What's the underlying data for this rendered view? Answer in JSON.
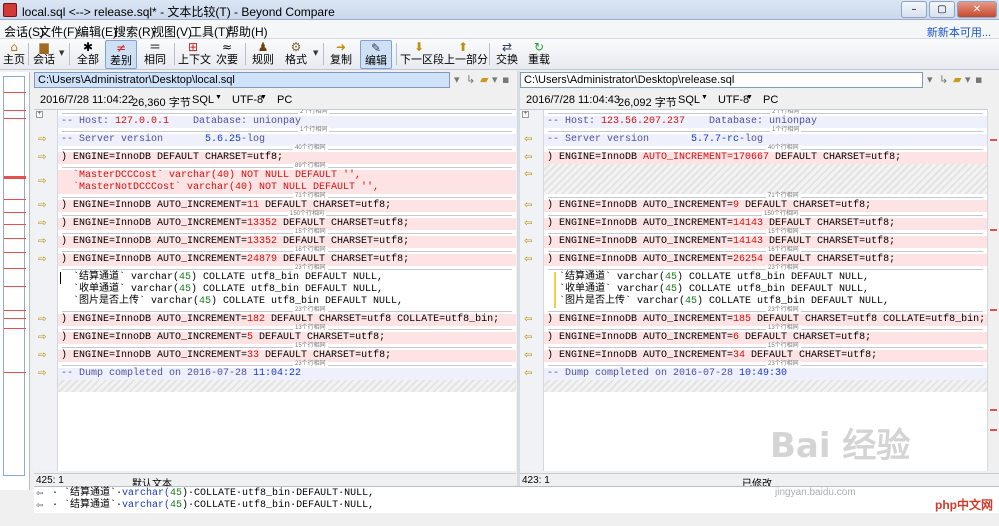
{
  "window": {
    "title": "local.sql <--> release.sql* - 文本比较(T) - Beyond Compare"
  },
  "menu": {
    "items": [
      "会话(S)",
      "文件(F)",
      "编辑(E)",
      "搜索(R)",
      "视图(V)",
      "工具(T)",
      "帮助(H)"
    ],
    "link": "新新本可用..."
  },
  "toolbar": {
    "items": [
      "主页",
      "会话",
      "全部",
      "差别",
      "相同",
      "上下文",
      "次要",
      "规则",
      "格式",
      "复制",
      "编辑",
      "下一区段",
      "上一部分",
      "交换",
      "重载"
    ]
  },
  "left": {
    "path": "C:\\Users\\Administrator\\Desktop\\local.sql",
    "date": "2016/7/28 11:04:22",
    "size": "26,360 字节",
    "lang": "SQL",
    "enc": "UTF-8",
    "eol": "PC",
    "status_pos": "425: 1",
    "status_mode": "默认文本"
  },
  "right": {
    "path": "C:\\Users\\Administrator\\Desktop\\release.sql",
    "date": "2016/7/28 11:04:43",
    "size": "26,092 字节",
    "lang": "SQL",
    "enc": "UTF-8",
    "eol": "PC",
    "status_pos": "423: 1",
    "status_mode": "已修改"
  },
  "sep_labels": [
    "2个行相同",
    "1个行相同",
    "40个行相同",
    "89个行相同",
    "71个行相同",
    "150个行相同",
    "15个行相同",
    "16个行相同",
    "23个行相同",
    "13个行相同",
    "15个行相同",
    "23个行相同"
  ],
  "sep_labels_right": [
    "2个行相同",
    "1个行相同",
    "40个行相同",
    "71个行相同",
    "150个行相同",
    "15个行相同",
    "16个行相同",
    "23个行相同",
    "13个行相同",
    "15个行相同",
    "23个行相同"
  ],
  "left_lines": {
    "host_a": "-- Host: ",
    "host_b": "127.0.0.1",
    "host_c": "    Database: unionpay",
    "ver_a": "-- Server version       ",
    "ver_b": "5.6.25",
    "ver_c": "-log",
    "l1": ") ENGINE=InnoDB DEFAULT CHARSET=utf8;",
    "mc_a": "  `MasterDCCCost` varchar(40) NOT NULL DEFAULT '',",
    "mc_b": "  `MasterNotDCCCost` varchar(40) NOT NULL DEFAULT '',",
    "l3a": ") ENGINE=InnoDB AUTO_INCREMENT=",
    "l3b": "11",
    "l3c": " DEFAULT CHARSET=utf8;",
    "l4a": ") ENGINE=InnoDB AUTO_INCREMENT=",
    "l4b": "13352",
    "l4c": " DEFAULT CHARSET=utf8;",
    "l5a": ") ENGINE=InnoDB AUTO_INCREMENT=",
    "l5b": "13352",
    "l5c": " DEFAULT CHARSET=utf8;",
    "l6a": ") ENGINE=InnoDB AUTO_INCREMENT=",
    "l6b": "24879",
    "l6c": " DEFAULT CHARSET=utf8;",
    "c1a": "  `结算通道` varchar(",
    "c1b": "45",
    "c1c": ") COLLATE utf8_bin DEFAULT NULL,",
    "c2a": "  `收单通道` varchar(",
    "c2b": "45",
    "c2c": ") COLLATE utf8_bin DEFAULT NULL,",
    "c3a": "  `图片是否上传` varchar(",
    "c3b": "45",
    "c3c": ") COLLATE utf8_bin DEFAULT NULL,",
    "l7a": ") ENGINE=InnoDB AUTO_INCREMENT=",
    "l7b": "182",
    "l7c": " DEFAULT CHARSET=utf8 COLLATE=utf8_bin;",
    "l8a": ") ENGINE=InnoDB AUTO_INCREMENT=",
    "l8b": "5",
    "l8c": " DEFAULT CHARSET=utf8;",
    "l9a": ") ENGINE=InnoDB AUTO_INCREMENT=",
    "l9b": "33",
    "l9c": " DEFAULT CHARSET=utf8;",
    "dump_a": "-- Dump completed on 2016-07-28 ",
    "dump_b": "11:04:22"
  },
  "right_lines": {
    "host_a": "-- Host: ",
    "host_b": "123.56.207.237",
    "host_c": "    Database: unionpay",
    "ver_a": "-- Server version       ",
    "ver_b": "5.7.7-rc",
    "ver_c": "-log",
    "l1a": ") ENGINE=InnoDB ",
    "l1b": "AUTO_INCREMENT=170667",
    "l1c": " DEFAULT CHARSET=utf8;",
    "l3a": ") ENGINE=InnoDB AUTO_INCREMENT=",
    "l3b": "9",
    "l3c": " DEFAULT CHARSET=utf8;",
    "l4a": ") ENGINE=InnoDB AUTO_INCREMENT=",
    "l4b": "14143",
    "l4c": " DEFAULT CHARSET=utf8;",
    "l5a": ") ENGINE=InnoDB AUTO_INCREMENT=",
    "l5b": "14143",
    "l5c": " DEFAULT CHARSET=utf8;",
    "l6a": ") ENGINE=InnoDB AUTO_INCREMENT=",
    "l6b": "26254",
    "l6c": " DEFAULT CHARSET=utf8;",
    "c1a": "  `结算通道` varchar(",
    "c1b": "45",
    "c1c": ") COLLATE utf8_bin DEFAULT NULL,",
    "c2a": "  `收单通道` varchar(",
    "c2b": "45",
    "c2c": ") COLLATE utf8_bin DEFAULT NULL,",
    "c3a": "  `图片是否上传` varchar(",
    "c3b": "45",
    "c3c": ") COLLATE utf8_bin DEFAULT NULL,",
    "l7a": ") ENGINE=InnoDB AUTO_INCREMENT=",
    "l7b": "185",
    "l7c": " DEFAULT CHARSET=utf8 COLLATE=utf8_bin;",
    "l8a": ") ENGINE=InnoDB AUTO_INCREMENT=",
    "l8b": "6",
    "l8c": " DEFAULT CHARSET=utf8;",
    "l9a": ") ENGINE=InnoDB AUTO_INCREMENT=",
    "l9b": "34",
    "l9c": " DEFAULT CHARSET=utf8;",
    "dump_a": "-- Dump completed on 2016-07-28 ",
    "dump_b": "10:49:30"
  },
  "bottom": {
    "a1": "· `结算通道`·",
    "a2": "varchar(",
    "a3": "45",
    "a4": ")·COLLATE·utf8_bin·DEFAULT·NULL,",
    "b1": "· `结算通道`·",
    "b2": "varchar(",
    "b3": "45",
    "b4": ")·COLLATE·utf8_bin·DEFAULT·NULL,"
  },
  "watermark": {
    "brand": "Bai 经验",
    "url": "jingyan.baidu.com",
    "site": "php中文网"
  }
}
